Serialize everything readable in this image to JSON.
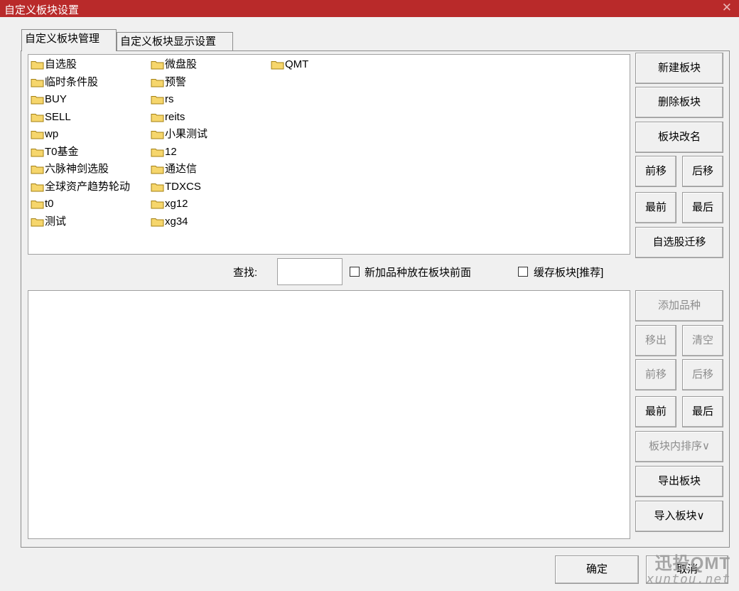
{
  "window": {
    "title": "自定义板块设置",
    "close_glyph": "✕"
  },
  "tabs": [
    {
      "label": "自定义板块管理",
      "active": true
    },
    {
      "label": "自定义板块显示设置",
      "active": false
    }
  ],
  "blocks": {
    "col1": [
      "自选股",
      "临时条件股",
      "BUY",
      "SELL",
      "wp",
      "T0基金",
      "六脉神剑选股",
      "全球资产趋势轮动",
      "t0",
      "测试"
    ],
    "col2": [
      "微盘股",
      "预警",
      "rs",
      "reits",
      "小果测试",
      "12",
      "通达信",
      "TDXCS",
      "xg12",
      "xg34"
    ],
    "col3": [
      "QMT"
    ]
  },
  "block_buttons": {
    "new": "新建板块",
    "delete": "删除板块",
    "rename": "板块改名",
    "move_up": "前移",
    "move_down": "后移",
    "move_first": "最前",
    "move_last": "最后",
    "migrate": "自选股迁移"
  },
  "search": {
    "label": "查找:",
    "value": ""
  },
  "options": {
    "add_front": {
      "label": "新加品种放在板块前面",
      "checked": false
    },
    "cache": {
      "label": "缓存板块[推荐]",
      "checked": false
    }
  },
  "item_buttons": {
    "add": "添加品种",
    "remove": "移出",
    "clear": "清空",
    "move_up": "前移",
    "move_down": "后移",
    "move_first": "最前",
    "move_last": "最后",
    "sort": "板块内排序∨",
    "export": "导出板块",
    "import": "导入板块∨"
  },
  "footer": {
    "ok": "确定",
    "cancel": "取消"
  },
  "watermark": {
    "line1": "迅投QMT",
    "line2": "xuntou.net"
  },
  "colors": {
    "titlebar": "#b92a2a",
    "folder": "#f6d66c",
    "folder_stroke": "#a48012"
  },
  "icons": {
    "folder": "folder-icon",
    "close": "close-icon"
  }
}
